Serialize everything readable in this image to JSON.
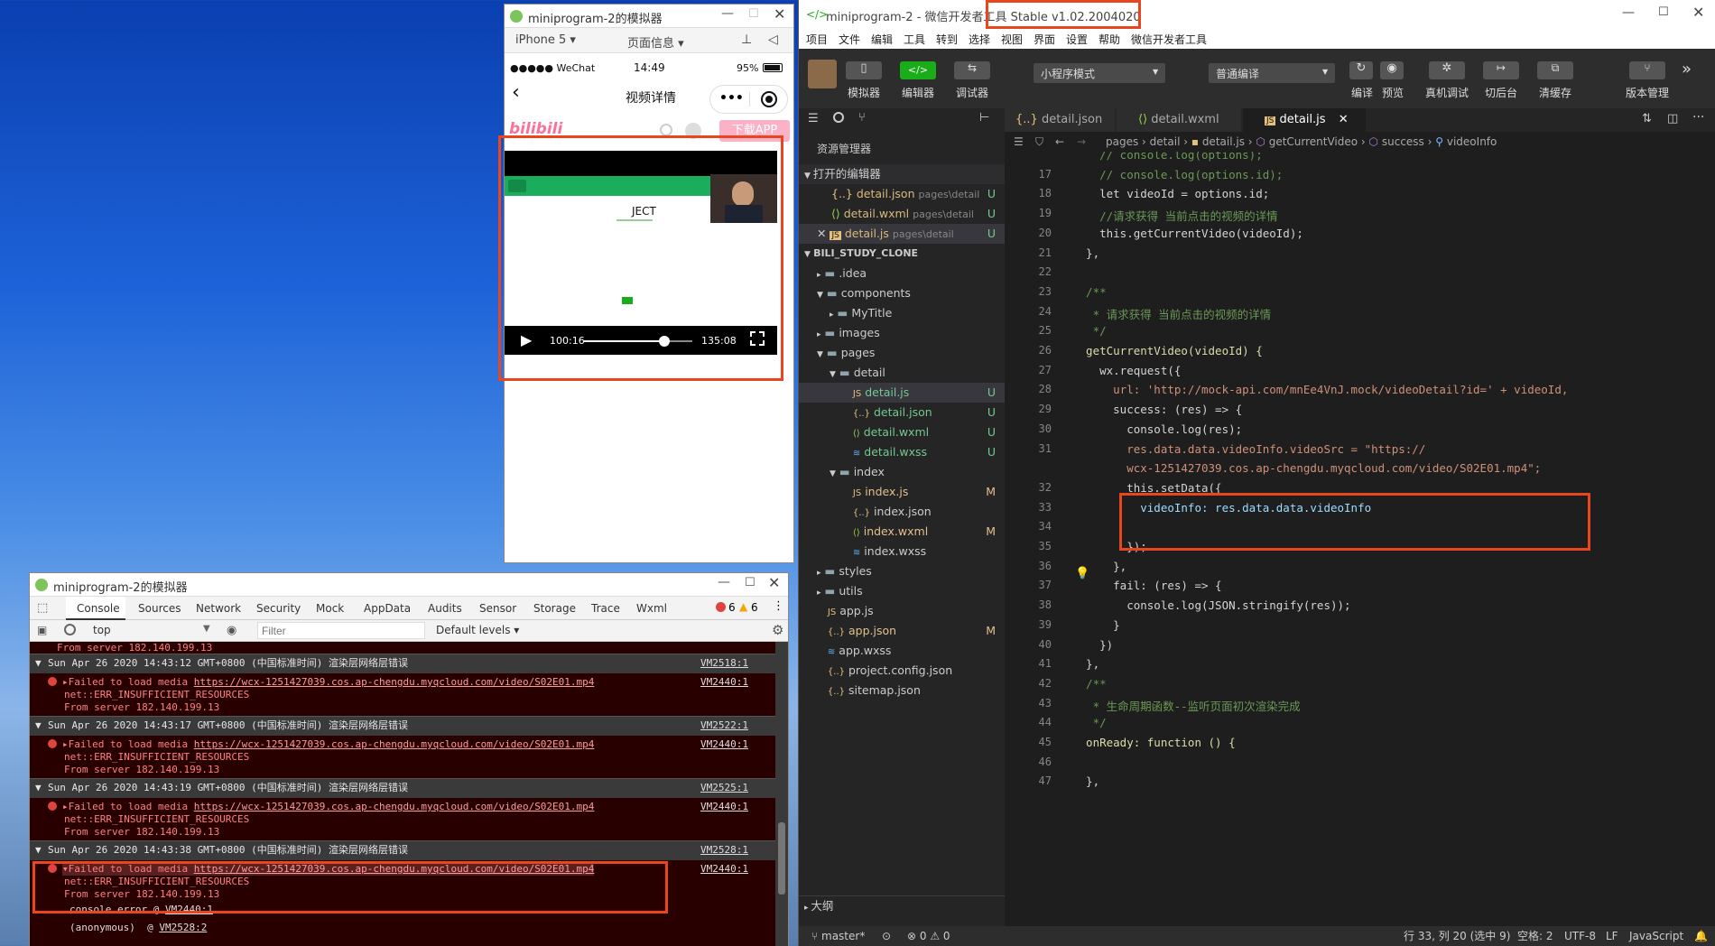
{
  "simulator": {
    "title": "miniprogram-2的模拟器",
    "device": "iPhone 5 ▾",
    "page_info": "页面信息 ▾",
    "status_carrier": "●●●●● WeChat",
    "status_time": "14:49",
    "status_battery": "95%",
    "nav_title": "视频详情",
    "nav_more": "•••",
    "logo_text": "bilibili",
    "download_btn": "下载APP",
    "video_title_text": "JECT",
    "video_current": "100:16",
    "video_total": "135:08",
    "video_progress": 0.74
  },
  "console": {
    "title": "miniprogram-2的模拟器",
    "tabs": [
      "Console",
      "Sources",
      "Network",
      "Security",
      "Mock",
      "AppData",
      "Audits",
      "Sensor",
      "Storage",
      "Trace",
      "Wxml"
    ],
    "error_count": "6",
    "warn_count": "6",
    "context": "top",
    "filter_placeholder": "Filter",
    "levels": "Default levels ▾",
    "top_line": "From server 182.140.199.13",
    "groups": [
      {
        "header": "Sun Apr 26 2020 14:43:12 GMT+0800 (中国标准时间) 渲染层网络层错误",
        "ref": "VM2518:1"
      },
      {
        "header": "Sun Apr 26 2020 14:43:17 GMT+0800 (中国标准时间) 渲染层网络层错误",
        "ref": "VM2522:1"
      },
      {
        "header": "Sun Apr 26 2020 14:43:19 GMT+0800 (中国标准时间) 渲染层网络层错误",
        "ref": "VM2525:1"
      },
      {
        "header": "Sun Apr 26 2020 14:43:38 GMT+0800 (中国标准时间) 渲染层网络层错误",
        "ref": "VM2528:1"
      }
    ],
    "error_prefix": "Failed to load media",
    "error_url": "https://wcx-1251427039.cos.ap-chengdu.myqcloud.com/video/S02E01.mp4",
    "error_ref": "VM2440:1",
    "error_line2": "net::ERR_INSUFFICIENT_RESOURCES",
    "error_line3": "From server 182.140.199.13",
    "stack1_label": "console.error @",
    "stack1_ref": "VM2440:1",
    "stack2_label": "(anonymous)",
    "stack2_ref": "VM2528:2"
  },
  "ide": {
    "title": "miniprogram-2 - 微信开发者工具 Stable v1.02.2004020",
    "menu": [
      "项目",
      "文件",
      "编辑",
      "工具",
      "转到",
      "选择",
      "视图",
      "界面",
      "设置",
      "帮助",
      "微信开发者工具"
    ],
    "toolbar": {
      "simulator": "模拟器",
      "editor": "编辑器",
      "debugger": "调试器",
      "mode": "小程序模式",
      "compile_mode": "普通编译",
      "compile": "编译",
      "preview": "预览",
      "real_debug": "真机调试",
      "background": "切后台",
      "clear_cache": "清缓存",
      "version": "版本管理"
    },
    "explorer_title": "资源管理器",
    "open_editors_label": "打开的编辑器",
    "open_editors": [
      {
        "name": "detail.json",
        "path": "pages\\detail",
        "status": "U"
      },
      {
        "name": "detail.wxml",
        "path": "pages\\detail",
        "status": "U"
      },
      {
        "name": "detail.js",
        "path": "pages\\detail",
        "status": "U"
      }
    ],
    "project_label": "BILI_STUDY_CLONE",
    "tree": [
      {
        "name": ".idea",
        "status": ""
      },
      {
        "name": "components",
        "status": ""
      },
      {
        "name": "MyTitle",
        "status": ""
      },
      {
        "name": "images",
        "status": ""
      },
      {
        "name": "pages",
        "status": ""
      },
      {
        "name": "detail",
        "status": ""
      },
      {
        "name": "detail.js",
        "status": "U"
      },
      {
        "name": "detail.json",
        "status": "U"
      },
      {
        "name": "detail.wxml",
        "status": "U"
      },
      {
        "name": "detail.wxss",
        "status": "U"
      },
      {
        "name": "index",
        "status": ""
      },
      {
        "name": "index.js",
        "status": "M"
      },
      {
        "name": "index.json",
        "status": ""
      },
      {
        "name": "index.wxml",
        "status": "M"
      },
      {
        "name": "index.wxss",
        "status": ""
      },
      {
        "name": "styles",
        "status": ""
      },
      {
        "name": "utils",
        "status": ""
      },
      {
        "name": "app.js",
        "status": ""
      },
      {
        "name": "app.json",
        "status": "M"
      },
      {
        "name": "app.wxss",
        "status": ""
      },
      {
        "name": "project.config.json",
        "status": ""
      },
      {
        "name": "sitemap.json",
        "status": ""
      }
    ],
    "outline_label": "大纲",
    "tabs": [
      "detail.json",
      "detail.wxml",
      "detail.js"
    ],
    "breadcrumb": [
      "pages",
      "detail",
      "detail.js",
      "getCurrentVideo",
      "success",
      "videoInfo"
    ],
    "code_lines": [
      {
        "n": "",
        "t": "    // console.log(options);"
      },
      {
        "n": "17",
        "t": "    // console.log(options.id);"
      },
      {
        "n": "18",
        "t": "    let videoId = options.id;"
      },
      {
        "n": "19",
        "t": "    //请求获得 当前点击的视频的详情"
      },
      {
        "n": "20",
        "t": "    this.getCurrentVideo(videoId);"
      },
      {
        "n": "21",
        "t": "  },"
      },
      {
        "n": "22",
        "t": ""
      },
      {
        "n": "23",
        "t": "  /**"
      },
      {
        "n": "24",
        "t": "   * 请求获得 当前点击的视频的详情"
      },
      {
        "n": "25",
        "t": "   */"
      },
      {
        "n": "26",
        "t": "  getCurrentVideo(videoId) {"
      },
      {
        "n": "27",
        "t": "    wx.request({"
      },
      {
        "n": "28",
        "t": "      url: 'http://mock-api.com/mnEe4VnJ.mock/videoDetail?id=' + videoId,"
      },
      {
        "n": "29",
        "t": "      success: (res) => {"
      },
      {
        "n": "30",
        "t": "        console.log(res);"
      },
      {
        "n": "31",
        "t": "        res.data.data.videoInfo.videoSrc = \"https://"
      },
      {
        "n": "",
        "t": "        wcx-1251427039.cos.ap-chengdu.myqcloud.com/video/S02E01.mp4\";"
      },
      {
        "n": "32",
        "t": "        this.setData({"
      },
      {
        "n": "33",
        "t": "          videoInfo: res.data.data.videoInfo"
      },
      {
        "n": "34",
        "t": ""
      },
      {
        "n": "35",
        "t": "        });"
      },
      {
        "n": "36",
        "t": "      },"
      },
      {
        "n": "37",
        "t": "      fail: (res) => {"
      },
      {
        "n": "38",
        "t": "        console.log(JSON.stringify(res));"
      },
      {
        "n": "39",
        "t": "      }"
      },
      {
        "n": "40",
        "t": "    })"
      },
      {
        "n": "41",
        "t": "  },"
      },
      {
        "n": "42",
        "t": "  /**"
      },
      {
        "n": "43",
        "t": "   * 生命周期函数--监听页面初次渲染完成"
      },
      {
        "n": "44",
        "t": "   */"
      },
      {
        "n": "45",
        "t": "  onReady: function () {"
      },
      {
        "n": "46",
        "t": ""
      },
      {
        "n": "47",
        "t": "  },"
      }
    ],
    "status": {
      "branch": "master*",
      "problems": "⊗ 0 ⚠ 0",
      "position": "行 33, 列 20 (选中 9)",
      "spaces": "空格: 2",
      "encoding": "UTF-8",
      "eol": "LF",
      "language": "JavaScript"
    }
  },
  "colors": {
    "highlight": "#e8461e",
    "accent_green": "#1aad19",
    "bili_pink": "#fb7299"
  }
}
